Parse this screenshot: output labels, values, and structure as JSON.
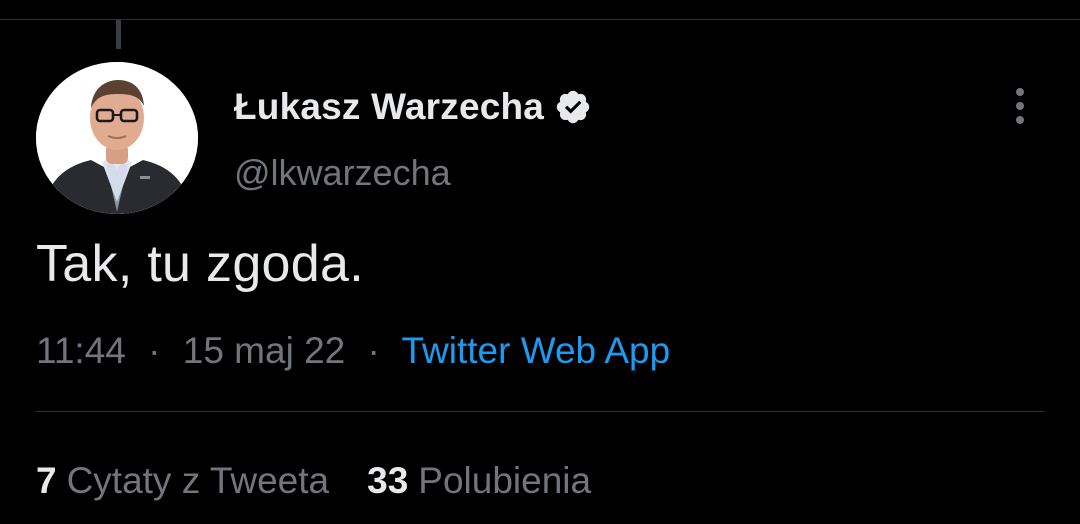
{
  "tweet": {
    "author": {
      "display_name": "Łukasz Warzecha",
      "handle": "@lkwarzecha",
      "verified": true,
      "verified_icon": "verified-badge-icon"
    },
    "text": "Tak, tu zgoda.",
    "time": "11:44",
    "date": "15 maj 22",
    "separator": "·",
    "source": "Twitter Web App"
  },
  "stats": {
    "quotes": {
      "count": "7",
      "label": "Cytaty z Tweeta"
    },
    "likes": {
      "count": "33",
      "label": "Polubienia"
    }
  },
  "menu": {
    "icon": "more-vertical-icon"
  },
  "colors": {
    "background": "#000000",
    "primary_text": "#e7e9ea",
    "secondary_text": "#71767b",
    "link": "#1d9bf0",
    "divider": "#2f3336"
  }
}
